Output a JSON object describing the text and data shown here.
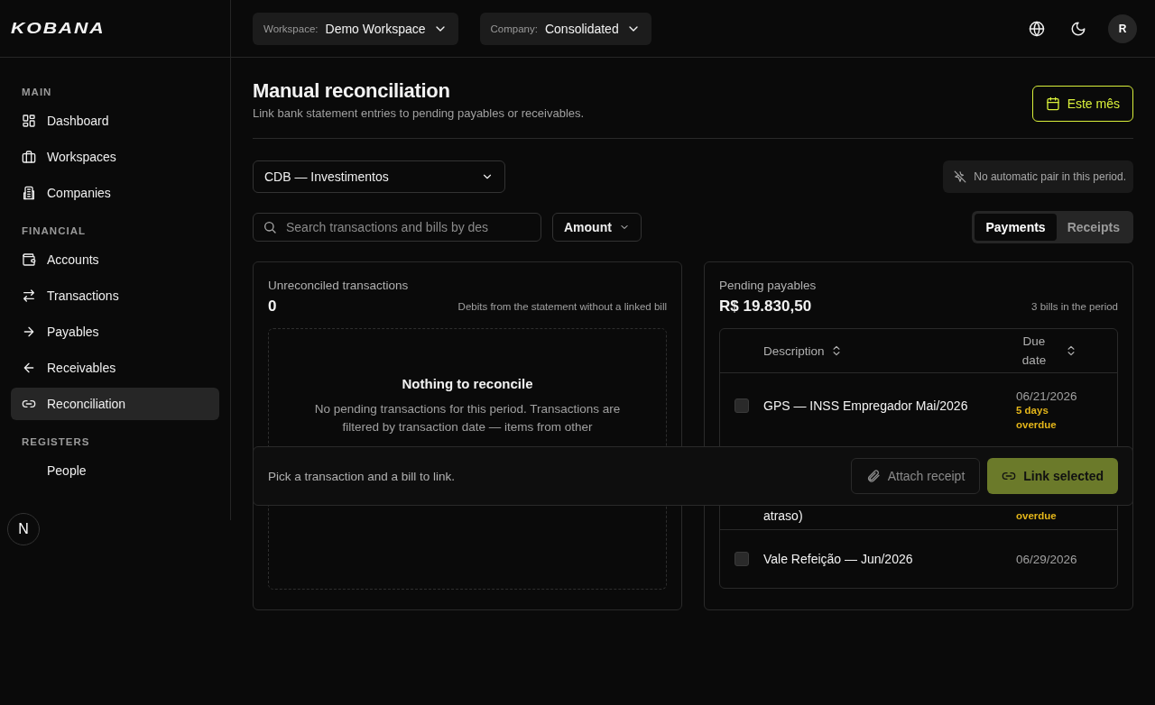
{
  "header": {
    "logo": "KOBANA",
    "selectors": [
      {
        "label": "Workspace:",
        "value": "Demo Workspace"
      },
      {
        "label": "Company:",
        "value": "Consolidated"
      }
    ],
    "avatar": "R"
  },
  "sidebar": {
    "sections": [
      {
        "title": "MAIN",
        "items": [
          {
            "label": "Dashboard",
            "selected": false
          },
          {
            "label": "Workspaces",
            "selected": false
          },
          {
            "label": "Companies",
            "selected": false
          }
        ]
      },
      {
        "title": "FINANCIAL",
        "items": [
          {
            "label": "Accounts",
            "selected": false
          },
          {
            "label": "Transactions",
            "selected": false
          },
          {
            "label": "Payables",
            "selected": false
          },
          {
            "label": "Receivables",
            "selected": false
          },
          {
            "label": "Reconciliation",
            "selected": true
          }
        ]
      },
      {
        "title": "REGISTERS",
        "items": [
          {
            "label": "People",
            "selected": false
          }
        ]
      }
    ]
  },
  "dev_badge": "N",
  "page": {
    "title": "Manual reconciliation",
    "subtitle": "Link bank statement entries to pending payables or receivables.",
    "period_button": "Este mês",
    "account_select": "CDB — Investimentos",
    "auto_pair_notice": "No automatic pair in this period.",
    "search": {
      "placeholder": "Search transactions and bills by des"
    },
    "amount_filter": "Amount",
    "tabs": [
      {
        "label": "Payments",
        "selected": true
      },
      {
        "label": "Receipts",
        "selected": false
      }
    ]
  },
  "transactions_panel": {
    "title": "Unreconciled transactions",
    "count": "0",
    "note": "Debits from the statement without a linked bill",
    "empty_title": "Nothing to reconcile",
    "empty_text": "No pending transactions for this period. Transactions are filtered by transaction date — items from other"
  },
  "payables_panel": {
    "title": "Pending payables",
    "total": "R$ 19.830,50",
    "note": "3 bills in the period",
    "columns": [
      "Description",
      "Due date"
    ],
    "rows": [
      {
        "description": "GPS — INSS Empregador Mai/2026",
        "due_date": "06/21/2026",
        "due_note": "5 days overdue",
        "checked": false
      },
      {
        "description": "atraso)",
        "due_note": "overdue"
      },
      {
        "description": "Vale Refeição — Jun/2026",
        "due_date": "06/29/2026",
        "checked": false
      }
    ]
  },
  "action_bar": {
    "hint": "Pick a transaction and a bill to link.",
    "buttons": [
      {
        "label": "Attach receipt",
        "kind": "secondary"
      },
      {
        "label": "Link selected",
        "kind": "primary"
      }
    ]
  }
}
